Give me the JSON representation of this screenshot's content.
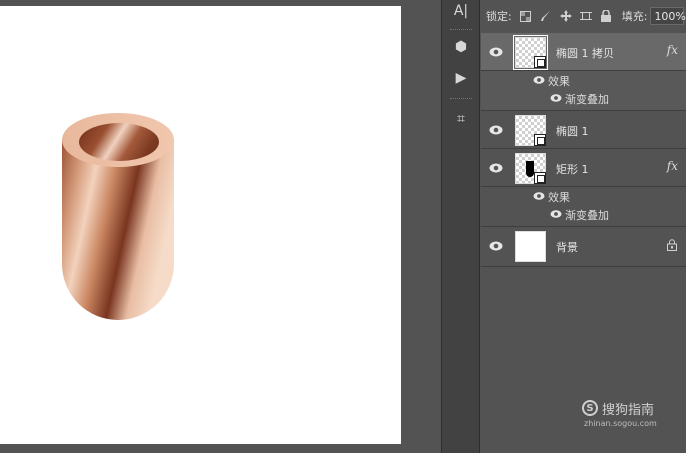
{
  "toolbar": {
    "tools": [
      {
        "name": "type-tool",
        "glyph": "A|"
      },
      {
        "name": "3d-tool",
        "glyph": "⬢"
      },
      {
        "name": "play-button",
        "glyph": "▶"
      },
      {
        "name": "crop-tool",
        "glyph": "⌗"
      }
    ]
  },
  "layers_panel": {
    "lock_label": "锁定:",
    "fill_label": "填充:",
    "fill_value": "100%",
    "layers": [
      {
        "name": "椭圆 1 拷贝",
        "fx": "fx",
        "selected": true,
        "effects_label": "效果",
        "effect": "渐变叠加"
      },
      {
        "name": "椭圆 1"
      },
      {
        "name": "矩形 1",
        "fx": "fx",
        "effects_label": "效果",
        "effect": "渐变叠加"
      },
      {
        "name": "背景",
        "locked": true
      }
    ]
  },
  "watermark": {
    "name": "搜狗指南",
    "url": "zhinan.sogou.com",
    "logo_letter": "S"
  },
  "colors": {
    "copper_dark": "#7a3a22",
    "copper_mid": "#c88a68",
    "copper_light": "#f2d0b8",
    "panel_bg": "#535353",
    "selected_row": "#696969"
  }
}
